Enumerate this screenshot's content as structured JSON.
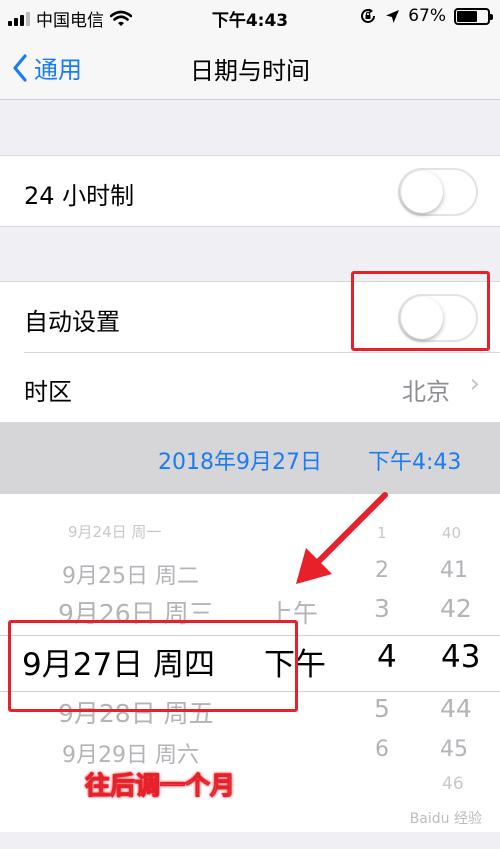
{
  "status": {
    "carrier": "中国电信",
    "time": "下午4:43",
    "battery": "67%",
    "battery_level": 0.67
  },
  "nav": {
    "back_label": "通用",
    "title": "日期与时间"
  },
  "rows": {
    "h24_label": "24 小时制",
    "auto_label": "自动设置",
    "tz_label": "时区",
    "tz_value": "北京"
  },
  "datebar": {
    "date": "2018年9月27日",
    "time": "下午4:43"
  },
  "picker": {
    "dates": [
      "9月24日 周一",
      "9月25日 周二",
      "9月26日 周三",
      "9月27日 周四",
      "9月28日 周五",
      "9月29日 周六"
    ],
    "ampm": [
      "上午",
      "下午"
    ],
    "hours": [
      "1",
      "2",
      "3",
      "4",
      "5",
      "6"
    ],
    "minutes": [
      "40",
      "41",
      "42",
      "43",
      "44",
      "45",
      "46"
    ]
  },
  "annotation": {
    "text": "往后调一个月"
  },
  "watermark": "Baidu 经验",
  "colors": {
    "accent": "#1a7cf5",
    "annotation_red": "#e8202a"
  }
}
